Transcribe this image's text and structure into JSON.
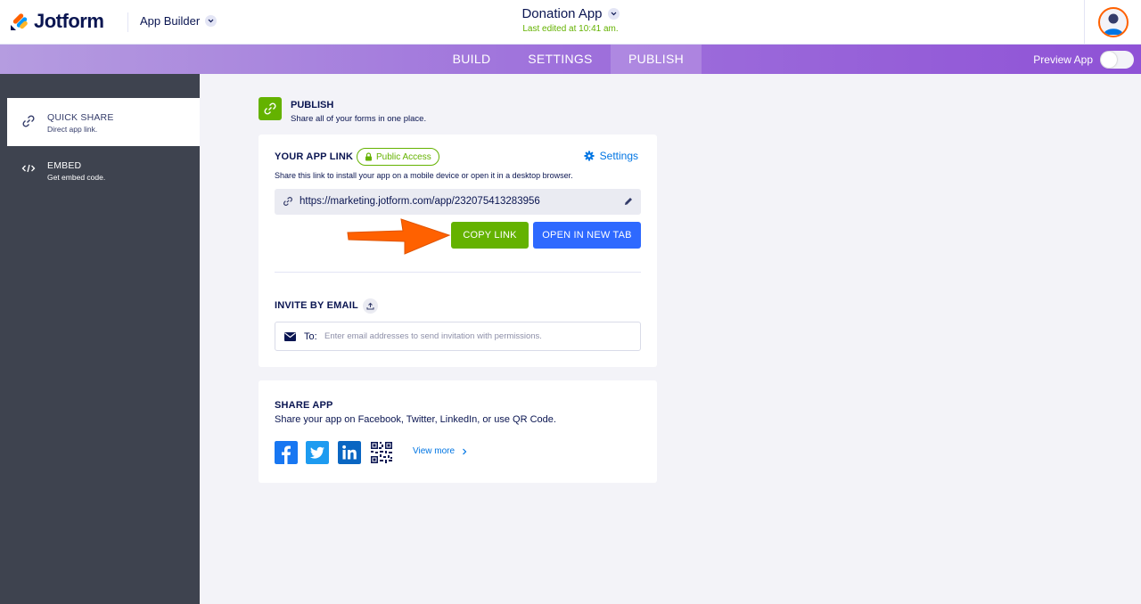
{
  "header": {
    "logo_text": "Jotform",
    "app_builder_label": "App Builder",
    "app_title": "Donation App",
    "last_edited": "Last edited at 10:41 am."
  },
  "nav": {
    "tabs": [
      {
        "label": "BUILD"
      },
      {
        "label": "SETTINGS"
      },
      {
        "label": "PUBLISH",
        "active": true
      }
    ],
    "preview_label": "Preview App"
  },
  "sidebar": {
    "items": [
      {
        "title": "QUICK SHARE",
        "desc": "Direct app link.",
        "icon": "link-icon",
        "active": true
      },
      {
        "title": "EMBED",
        "desc": "Get embed code.",
        "icon": "code-icon",
        "active": false
      }
    ]
  },
  "publish": {
    "title": "PUBLISH",
    "desc": "Share all of your forms in one place."
  },
  "app_link": {
    "label": "YOUR APP LINK",
    "badge": "Public Access",
    "settings_label": "Settings",
    "hint": "Share this link to install your app on a mobile device or open it in a desktop browser.",
    "url": "https://marketing.jotform.com/app/232075413283956",
    "copy_label": "COPY LINK",
    "open_label": "OPEN IN NEW TAB"
  },
  "invite": {
    "label": "INVITE BY EMAIL",
    "to_label": "To:",
    "placeholder": "Enter email addresses to send invitation with permissions."
  },
  "share_app": {
    "label": "SHARE APP",
    "desc": "Share your app on Facebook, Twitter, LinkedIn, or use QR Code.",
    "view_more": "View more",
    "icons": [
      "facebook-icon",
      "twitter-icon",
      "linkedin-icon",
      "qr-code-icon"
    ]
  },
  "colors": {
    "accent_green": "#64b200",
    "accent_blue": "#2e69ff",
    "link_blue": "#0075e3",
    "sidebar_dark": "#3e434f",
    "annotation_arrow": "#ff6100"
  }
}
